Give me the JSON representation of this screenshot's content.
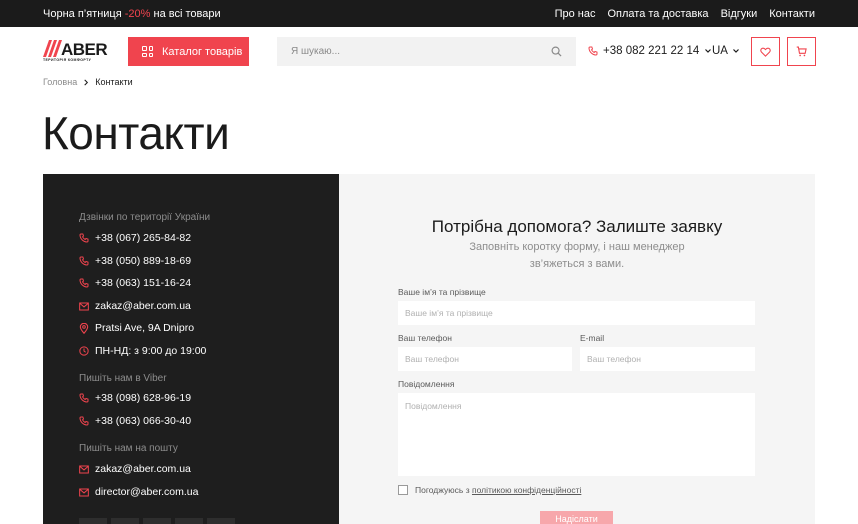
{
  "topbar": {
    "promo_prefix": "Чорна п’ятниця",
    "promo_percent": "-20%",
    "promo_suffix": "на всі товари",
    "links": [
      "Про нас",
      "Оплата та доставка",
      "Відгуки",
      "Контакти"
    ]
  },
  "header": {
    "logo_name": "ABER",
    "logo_tagline": "ТЕРИТОРІЯ КОМФОРТУ",
    "catalog_label": "Каталог товарів",
    "search_placeholder": "Я шукаю...",
    "phone": "+38 082 221 22 14",
    "language": "UA"
  },
  "breadcrumb": {
    "home": "Головна",
    "current": "Контакти"
  },
  "page_title": "Контакти",
  "contacts": {
    "calls_heading": "Дзвінки по території України",
    "calls": [
      "+38 (067) 265-84-82",
      "+38 (050) 889-18-69",
      "+38 (063) 151-16-24"
    ],
    "email": "zakaz@aber.com.ua",
    "address": "Pratsi Ave, 9A Dnipro",
    "hours": "ПН-НД: з 9:00 до 19:00",
    "viber_heading": "Пишіть нам в Viber",
    "viber": [
      "+38 (098) 628-96-19",
      "+38 (063) 066-30-40"
    ],
    "mail_heading": "Пишіть нам на пошту",
    "mails": [
      "zakaz@aber.com.ua",
      "director@aber.com.ua"
    ]
  },
  "form": {
    "title": "Потрібна допомога? Залиште заявку",
    "subtitle": "Заповніть коротку форму, і наш менеджер зв’яжеться з вами.",
    "name_label": "Ваше ім’я та прізвище",
    "name_placeholder": "Ваше ім’я та прізвище",
    "phone_label": "Ваш телефон",
    "phone_placeholder": "Ваш телефон",
    "email_label": "E-mail",
    "email_placeholder": "Ваш телефон",
    "message_label": "Повідомлення",
    "message_placeholder": "Повідомлення",
    "consent_text": "Погоджуюсь з",
    "consent_link": "політикою конфіденційності",
    "submit_label": "Надіслати"
  },
  "colors": {
    "accent": "#f0444e",
    "dark_panel": "#1e1e1e",
    "form_bg": "#f5f5f5"
  }
}
